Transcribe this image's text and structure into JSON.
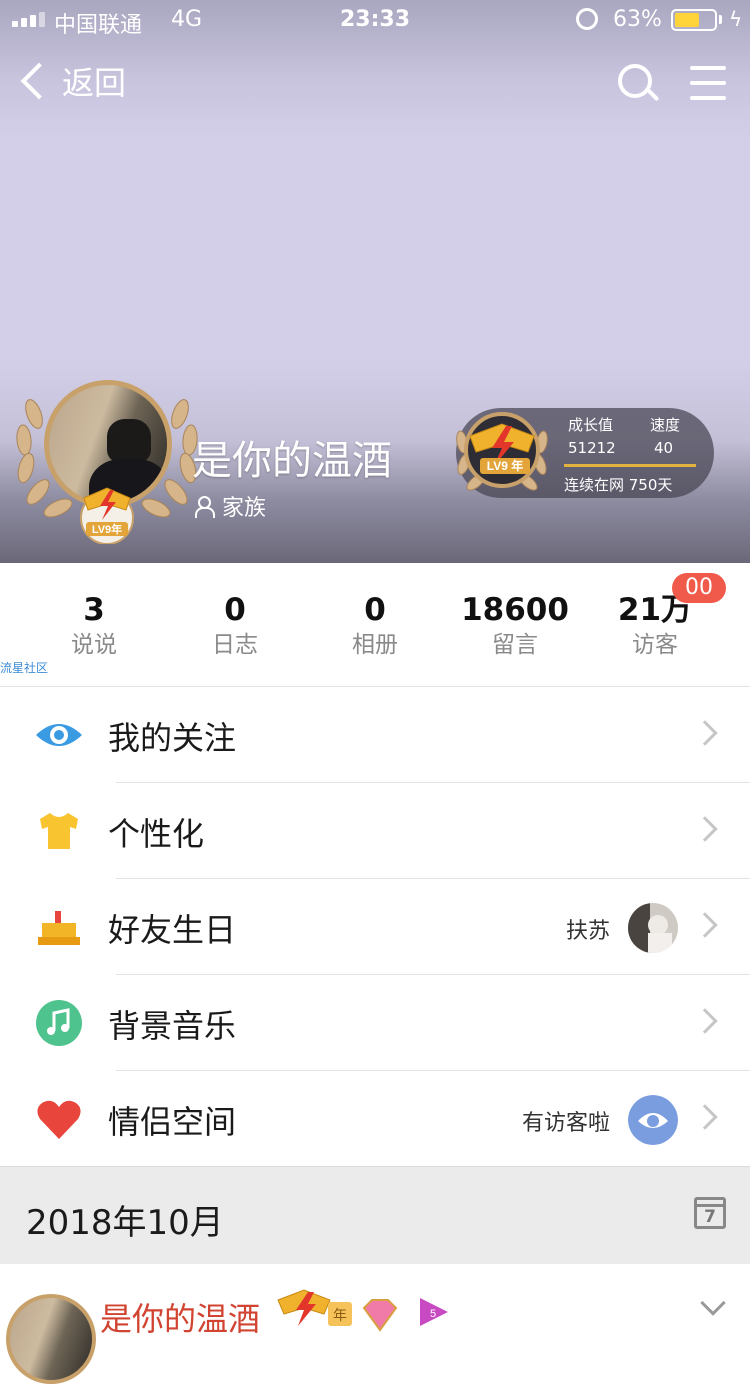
{
  "status_bar": {
    "carrier": "中国联通",
    "network": "4G",
    "time": "23:33",
    "battery_percent": "63%",
    "battery_level": 0.63
  },
  "nav": {
    "back_label": "返回"
  },
  "profile": {
    "name": "是你的温酒",
    "family_label": "家族",
    "level_text": "LV9",
    "year_text": "年"
  },
  "growth": {
    "growth_label": "成长值",
    "speed_label": "速度",
    "growth_value": "51212",
    "speed_value": "40",
    "online_days": "连续在网  750天"
  },
  "stats": [
    {
      "value": "3",
      "label": "说说"
    },
    {
      "value": "0",
      "label": "日志"
    },
    {
      "value": "0",
      "label": "相册"
    },
    {
      "value": "18600",
      "label": "留言"
    },
    {
      "value": "21万",
      "label": "访客"
    }
  ],
  "visitor_badge": "00",
  "watermark": "流星社区",
  "menu": [
    {
      "label": "我的关注",
      "icon": "eye-icon",
      "color": "#3a9be2",
      "extra": ""
    },
    {
      "label": "个性化",
      "icon": "tshirt-icon",
      "color": "#f8c531",
      "extra": ""
    },
    {
      "label": "好友生日",
      "icon": "cake-icon",
      "color": "#f3b528",
      "extra": "扶苏"
    },
    {
      "label": "背景音乐",
      "icon": "music-icon",
      "color": "#4fc38d",
      "extra": ""
    },
    {
      "label": "情侣空间",
      "icon": "heart-icon",
      "color": "#e8453c",
      "extra": "有访客啦"
    }
  ],
  "month": {
    "label": "2018年10月",
    "calendar_day": "7"
  },
  "feed": {
    "name": "是你的温酒"
  }
}
